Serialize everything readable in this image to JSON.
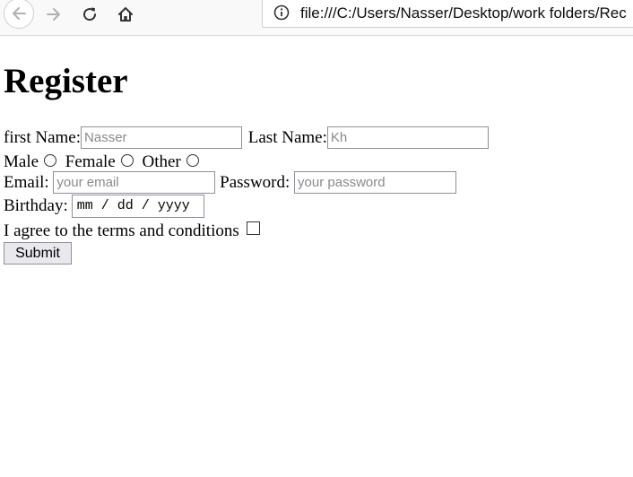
{
  "browser": {
    "url": "file:///C:/Users/Nasser/Desktop/work folders/Rec"
  },
  "form": {
    "title": "Register",
    "first_name_label": "first Name:",
    "first_name_placeholder": "Nasser",
    "last_name_label": "Last Name:",
    "last_name_placeholder": "Kh",
    "gender_options": [
      "Male",
      "Female",
      "Other"
    ],
    "email_label": "Email:",
    "email_placeholder": "your email",
    "password_label": "Password:",
    "password_placeholder": "your password",
    "birthday_label": "Birthday:",
    "birthday_placeholder": "mm / dd / yyyy",
    "terms_label": "I agree to the terms and conditions",
    "submit_label": "Submit"
  }
}
